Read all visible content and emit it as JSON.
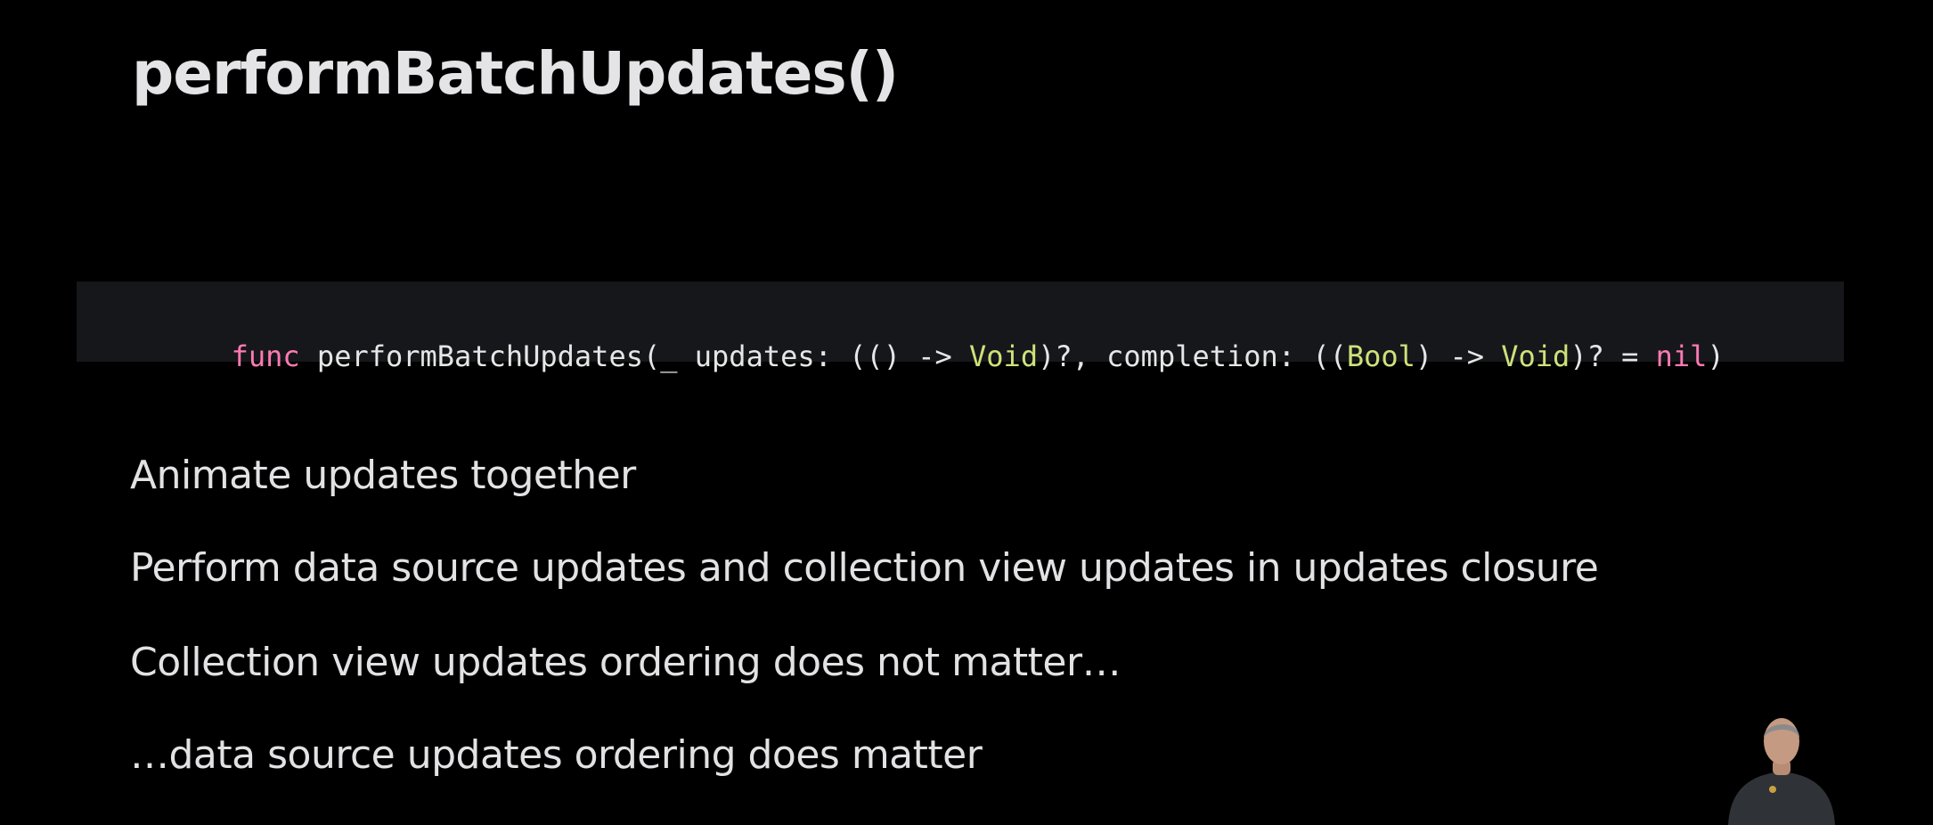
{
  "slide": {
    "title": "performBatchUpdates()",
    "code": {
      "tokens": [
        {
          "text": "func",
          "kind": "keyword"
        },
        {
          "text": " performBatchUpdates(_ updates: (() -> ",
          "kind": "plain"
        },
        {
          "text": "Void",
          "kind": "type"
        },
        {
          "text": ")?, completion: ((",
          "kind": "plain"
        },
        {
          "text": "Bool",
          "kind": "type"
        },
        {
          "text": ") -> ",
          "kind": "plain"
        },
        {
          "text": "Void",
          "kind": "type"
        },
        {
          "text": ")? = ",
          "kind": "plain"
        },
        {
          "text": "nil",
          "kind": "keyword"
        },
        {
          "text": ")",
          "kind": "plain"
        }
      ]
    },
    "bullets": [
      "Animate updates together",
      "Perform data source updates and collection view updates in updates closure",
      "Collection view updates ordering does not matter…",
      "…data source updates ordering does matter"
    ]
  },
  "colors": {
    "background": "#000000",
    "title": "#e4e4e6",
    "code_background": "#16171b",
    "keyword": "#ff7ab2",
    "type": "#d0e17a",
    "plain": "#e6e6e6"
  }
}
